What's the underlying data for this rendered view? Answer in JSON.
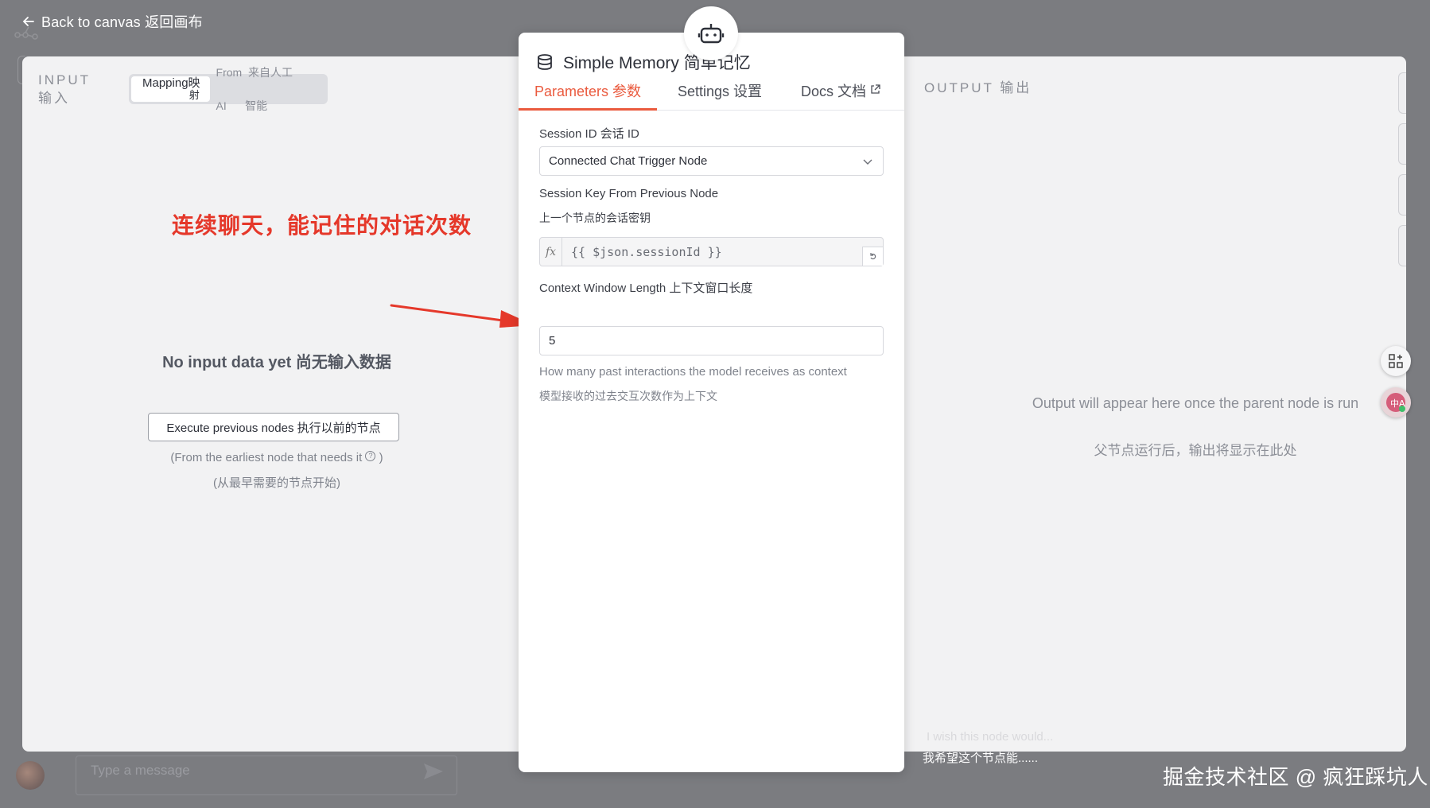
{
  "header": {
    "back_label": "Back to canvas  返回画布"
  },
  "input_panel": {
    "section_label_en": "INPUT",
    "section_label_cn": "输入",
    "mode_tabs": [
      {
        "label_line1": "Mapping映",
        "label_line2": "射",
        "active": true
      },
      {
        "label_line1": "From  来自人工",
        "label_line2": "AI      智能",
        "active": false
      }
    ],
    "empty_title": "No input data yet  尚无输入数据",
    "execute_button": "Execute previous nodes  执行以前的节点",
    "execute_note": "(From the earliest node that needs it",
    "execute_note_close": ")",
    "execute_note_cn": "(从最早需要的节点开始)"
  },
  "annotation": {
    "text": "连续聊天，能记住的对话次数",
    "color": "#e5382a"
  },
  "node": {
    "title": "Simple Memory  简单记忆",
    "tabs": {
      "parameters": "Parameters  参数",
      "settings": "Settings  设置",
      "docs": "Docs   文档"
    },
    "session_id_label": "Session ID   会话 ID",
    "session_id_value": "Connected Chat Trigger Node",
    "session_key_label": "Session Key From Previous Node",
    "session_key_label_cn": "上一个节点的会话密钥",
    "session_key_value": "{{ $json.sessionId }}",
    "context_label": "Context Window Length   上下文窗口长度",
    "context_value": "5",
    "context_hint": "How many past interactions the model receives as context",
    "context_hint_cn": "模型接收的过去交互次数作为上下文",
    "accent_color": "#ea5a3e"
  },
  "output_panel": {
    "section_label": "OUTPUT   输出",
    "empty_message": "Output will appear here once the parent node is run",
    "empty_message_cn": "父节点运行后，输出将显示在此处"
  },
  "footer": {
    "chat_placeholder": "Type a message",
    "wish_text": "I wish this node would...",
    "wish_text_cn": "我希望这个节点能......",
    "watermark": "掘金技术社区 @ 疯狂踩坑人"
  }
}
